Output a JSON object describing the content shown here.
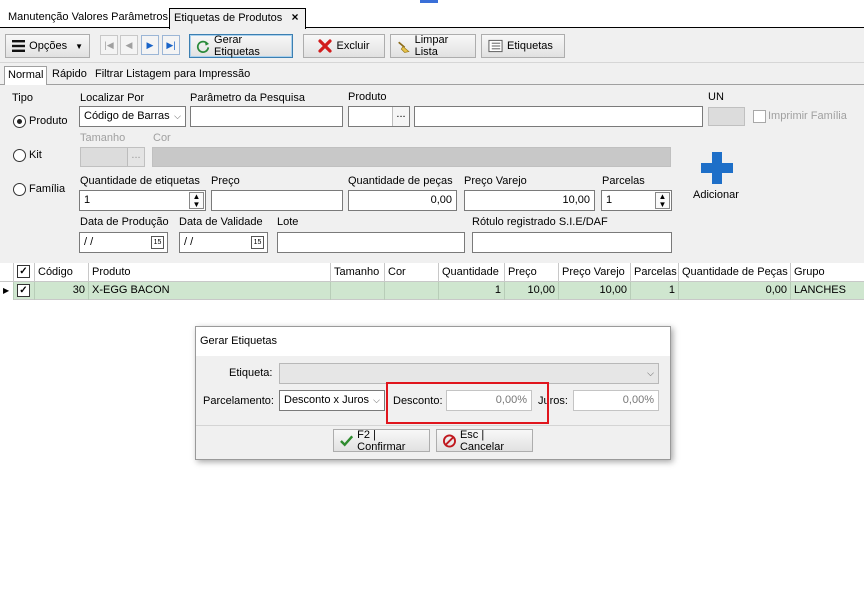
{
  "tabs": [
    {
      "label": "Manutenção Valores Parâmetros"
    },
    {
      "label": "Etiquetas de Produtos",
      "close": "×"
    }
  ],
  "toolbar": {
    "options_label": "Opções",
    "gerar_label": "Gerar Etiquetas",
    "excluir_label": "Excluir",
    "limpar_label": "Limpar Lista",
    "etiquetas_label": "Etiquetas",
    "nav_first": "|◀",
    "nav_prev": "◀",
    "nav_next": "▶",
    "nav_last": "▶|"
  },
  "subtabs": [
    "Normal",
    "Rápido",
    "Filtrar Listagem para Impressão"
  ],
  "form": {
    "tipo_label": "Tipo",
    "tipo_options": [
      "Produto",
      "Kit",
      "Família"
    ],
    "localizar_label": "Localizar Por",
    "localizar_value": "Código de Barras",
    "parametro_label": "Parâmetro da Pesquisa",
    "produto_label": "Produto",
    "un_label": "UN",
    "imprimir_familia_label": "Imprimir Família",
    "tamanho_label": "Tamanho",
    "cor_label": "Cor",
    "qtd_etiquetas_label": "Quantidade de etiquetas",
    "qtd_etiquetas_value": "1",
    "preco_label": "Preço",
    "qtd_pecas_label": "Quantidade de peças",
    "qtd_pecas_value": "0,00",
    "preco_varejo_label": "Preço Varejo",
    "preco_varejo_value": "10,00",
    "parcelas_label": "Parcelas",
    "parcelas_value": "1",
    "adicionar_label": "Adicionar",
    "data_producao_label": "Data de Produção",
    "data_producao_value": " / /",
    "data_validade_label": "Data de Validade",
    "data_validade_value": " / /",
    "lote_label": "Lote",
    "rotulo_label": "Rótulo registrado S.I.E/DAF",
    "calendar_glyph": "15",
    "ellipsis": "..."
  },
  "grid": {
    "columns": [
      "Código",
      "Produto",
      "Tamanho",
      "Cor",
      "Quantidade",
      "Preço",
      "Preço Varejo",
      "Parcelas",
      "Quantidade de Peças",
      "Grupo"
    ],
    "rows": [
      {
        "codigo": "30",
        "produto": "X-EGG BACON",
        "tamanho": "",
        "cor": "",
        "quantidade": "1",
        "preco": "10,00",
        "preco_varejo": "10,00",
        "parcelas": "1",
        "qtd_pecas": "0,00",
        "grupo": "LANCHES"
      }
    ]
  },
  "dialog": {
    "title": "Gerar Etiquetas",
    "etiqueta_label": "Etiqueta:",
    "parcelamento_label": "Parcelamento:",
    "parcelamento_value": "Desconto x Juros",
    "desconto_label": "Desconto:",
    "desconto_value": "0,00%",
    "juros_label": "Juros:",
    "juros_value": "0,00%",
    "confirmar_label": "F2 | Confirmar",
    "cancelar_label": "Esc | Cancelar"
  },
  "colors": {
    "highlight_box": "#e0151d",
    "row_selected": "#cfe6cf",
    "plus_icon": "#1e6fc8"
  },
  "icons": [
    "hamburger-icon",
    "refresh-icon",
    "delete-x-icon",
    "broom-icon",
    "labels-icon",
    "plus-icon",
    "check-icon",
    "cancel-icon",
    "calendar-icon",
    "spinner-icon",
    "row-pointer-icon"
  ]
}
